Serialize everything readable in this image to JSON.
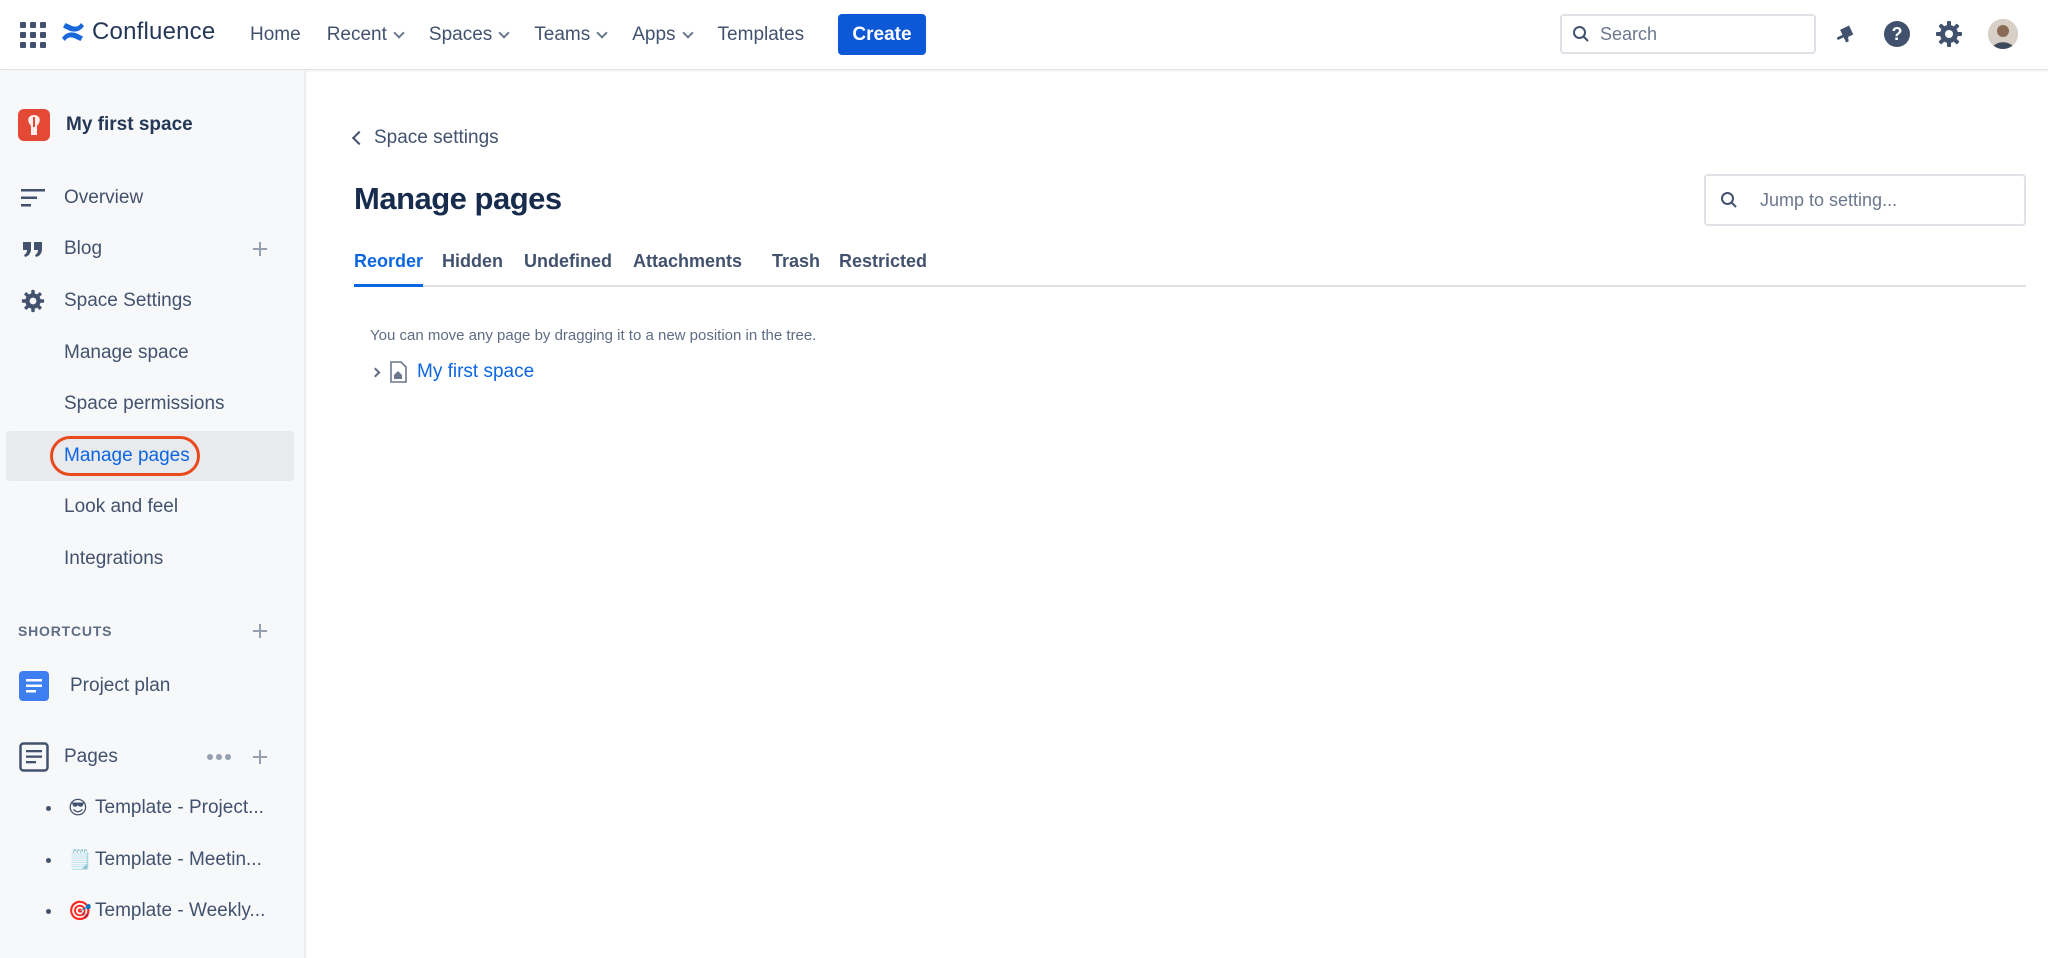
{
  "topbar": {
    "app_name": "Confluence",
    "nav": {
      "home": "Home",
      "recent": "Recent",
      "spaces": "Spaces",
      "teams": "Teams",
      "apps": "Apps",
      "templates": "Templates"
    },
    "create_label": "Create",
    "search_placeholder": "Search",
    "icons": [
      "notifications-icon",
      "help-icon",
      "settings-icon",
      "profile-avatar"
    ]
  },
  "sidebar": {
    "space_name": "My first space",
    "items": [
      {
        "label": "Overview",
        "icon": "overview-icon"
      },
      {
        "label": "Blog",
        "icon": "blog-quote-icon"
      },
      {
        "label": "Space Settings",
        "icon": "gear-icon"
      }
    ],
    "settings_sub": [
      {
        "label": "Manage space"
      },
      {
        "label": "Space permissions"
      },
      {
        "label": "Manage pages",
        "active": true
      },
      {
        "label": "Look and feel"
      },
      {
        "label": "Integrations"
      }
    ],
    "shortcuts_title": "SHORTCUTS",
    "shortcuts": [
      {
        "label": "Project plan",
        "icon": "document-icon"
      }
    ],
    "pages_label": "Pages",
    "pages": [
      {
        "emoji": "😎",
        "label": "Template - Project..."
      },
      {
        "emoji": "🗒️",
        "label": "Template - Meetin..."
      },
      {
        "emoji": "🎯",
        "label": "Template - Weekly..."
      }
    ]
  },
  "main": {
    "back_label": "Space settings",
    "title": "Manage pages",
    "jump_placeholder": "Jump to setting...",
    "tabs": [
      "Reorder",
      "Hidden",
      "Undefined",
      "Attachments",
      "Trash",
      "Restricted"
    ],
    "active_tab": "Reorder",
    "hint": "You can move any page by dragging it to a new position in the tree.",
    "tree_root": "My first space"
  },
  "colors": {
    "accent": "#0c66e4",
    "create_button": "#0c58d6",
    "highlight_ring": "#e8491d",
    "space_avatar": "#e34935"
  }
}
